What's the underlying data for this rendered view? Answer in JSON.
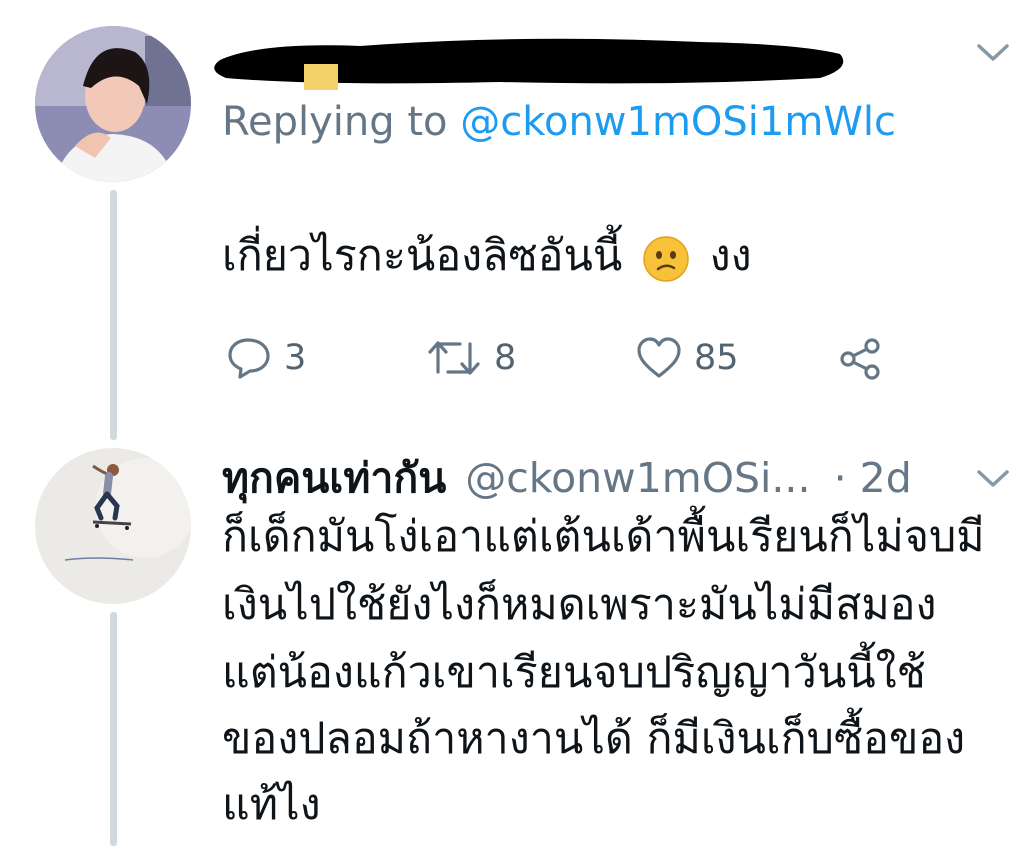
{
  "tweet1": {
    "replying_prefix": "Replying to",
    "replying_handle": "@ckonw1mOSi1mWlc",
    "text": "เกี่ยวไรกะน้องลิซอันนี้",
    "emoji": "🙁",
    "text_after": "งง",
    "actions": {
      "reply_count": "3",
      "retweet_count": "8",
      "like_count": "85"
    }
  },
  "tweet2": {
    "display_name": "ทุกคนเท่ากัน",
    "handle": "@ckonw1mOSi...",
    "time": "· 2d",
    "lines": [
      "ก็เด็กมันโง่เอาแต่เต้นเด้าพื้นเรียนก็ไม่จบมี",
      "เงินไปใช้ยังไงก็หมดเพราะมันไม่มีสมอง",
      "แต่น้องแก้วเขาเรียนจบปริญญาวันนี้ใช้",
      "ของปลอมถ้าหางานได้ ก็มีเงินเก็บซื้อของ",
      "แท้ไง"
    ]
  },
  "colors": {
    "link": "#1d9bf0",
    "muted": "#657786",
    "thread": "#cfd9de"
  },
  "icons": [
    "chevron-down-icon",
    "reply-icon",
    "retweet-icon",
    "like-icon",
    "share-icon"
  ]
}
